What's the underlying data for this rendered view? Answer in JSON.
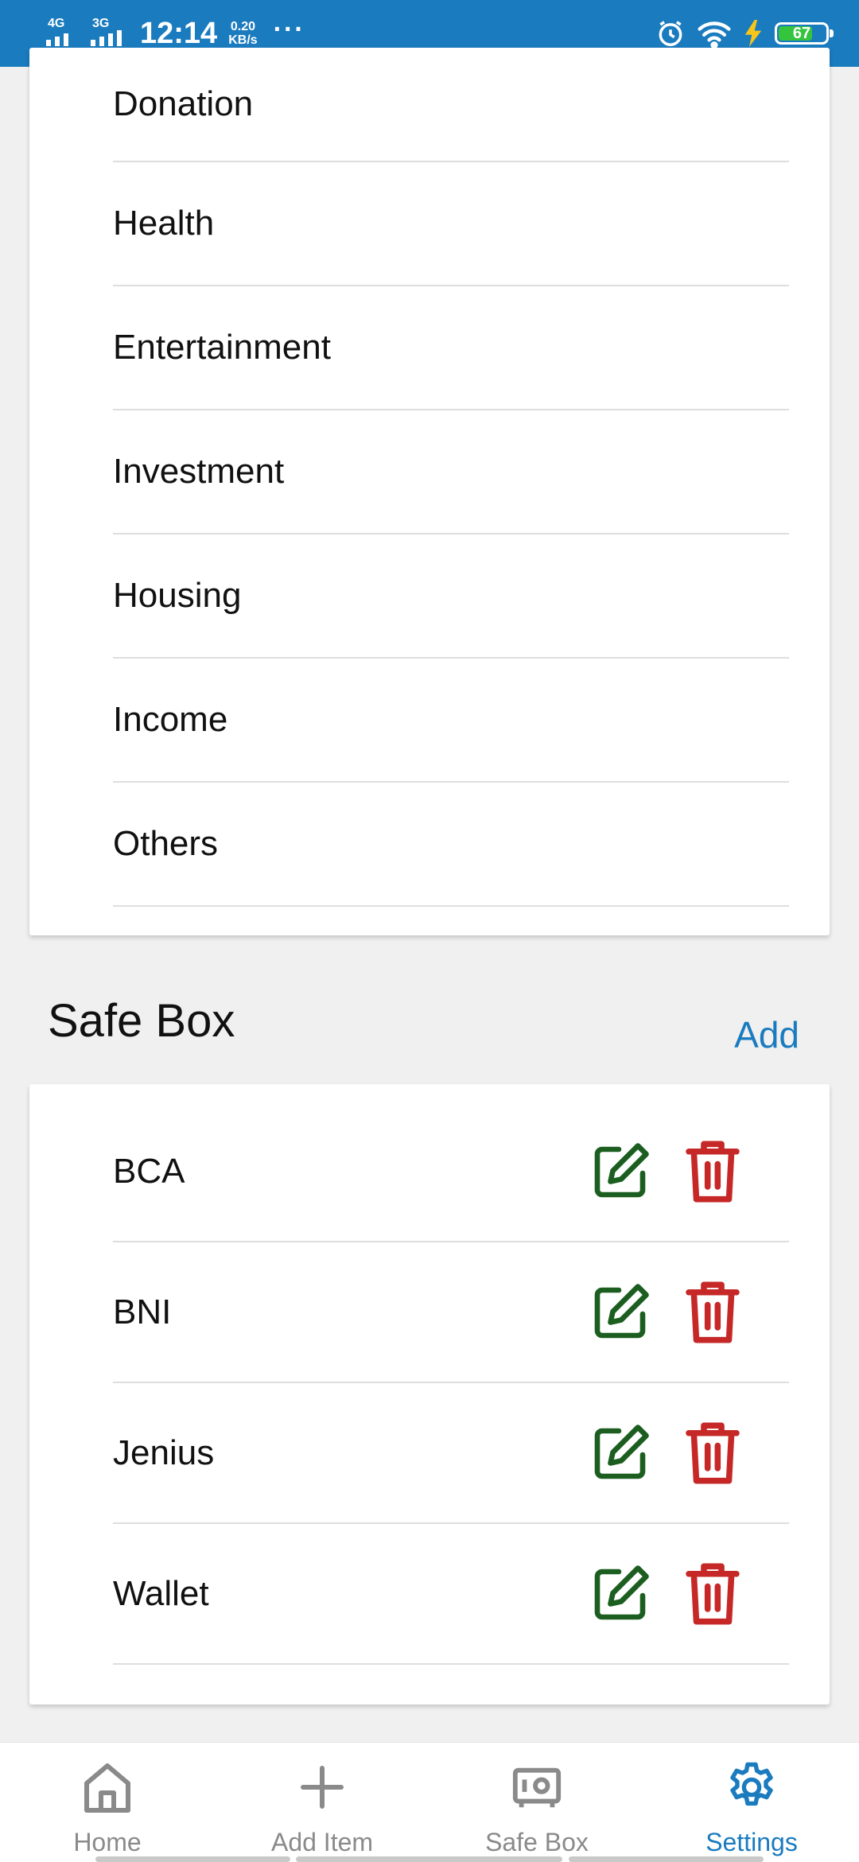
{
  "status_bar": {
    "net1": "4G",
    "net2": "3G",
    "time": "12:14",
    "speed_value": "0.20",
    "speed_unit": "KB/s",
    "more": "···",
    "battery": "67",
    "icons": [
      "alarm-icon",
      "wifi-icon",
      "charging-icon",
      "battery-icon"
    ]
  },
  "categories": {
    "items": [
      "Donation",
      "Health",
      "Entertainment",
      "Investment",
      "Housing",
      "Income",
      "Others"
    ]
  },
  "safe_box": {
    "title": "Safe Box",
    "add_label": "Add",
    "items": [
      "BCA",
      "BNI",
      "Jenius",
      "Wallet"
    ]
  },
  "bottom_nav": {
    "tabs": [
      {
        "label": "Home",
        "icon": "home-icon"
      },
      {
        "label": "Add Item",
        "icon": "plus-icon"
      },
      {
        "label": "Safe Box",
        "icon": "safe-icon"
      },
      {
        "label": "Settings",
        "icon": "gear-icon",
        "active": true
      }
    ]
  },
  "colors": {
    "accent": "#1a7bbf",
    "edit": "#1b5e20",
    "delete": "#c62828",
    "inactive": "#8a8a8a"
  }
}
